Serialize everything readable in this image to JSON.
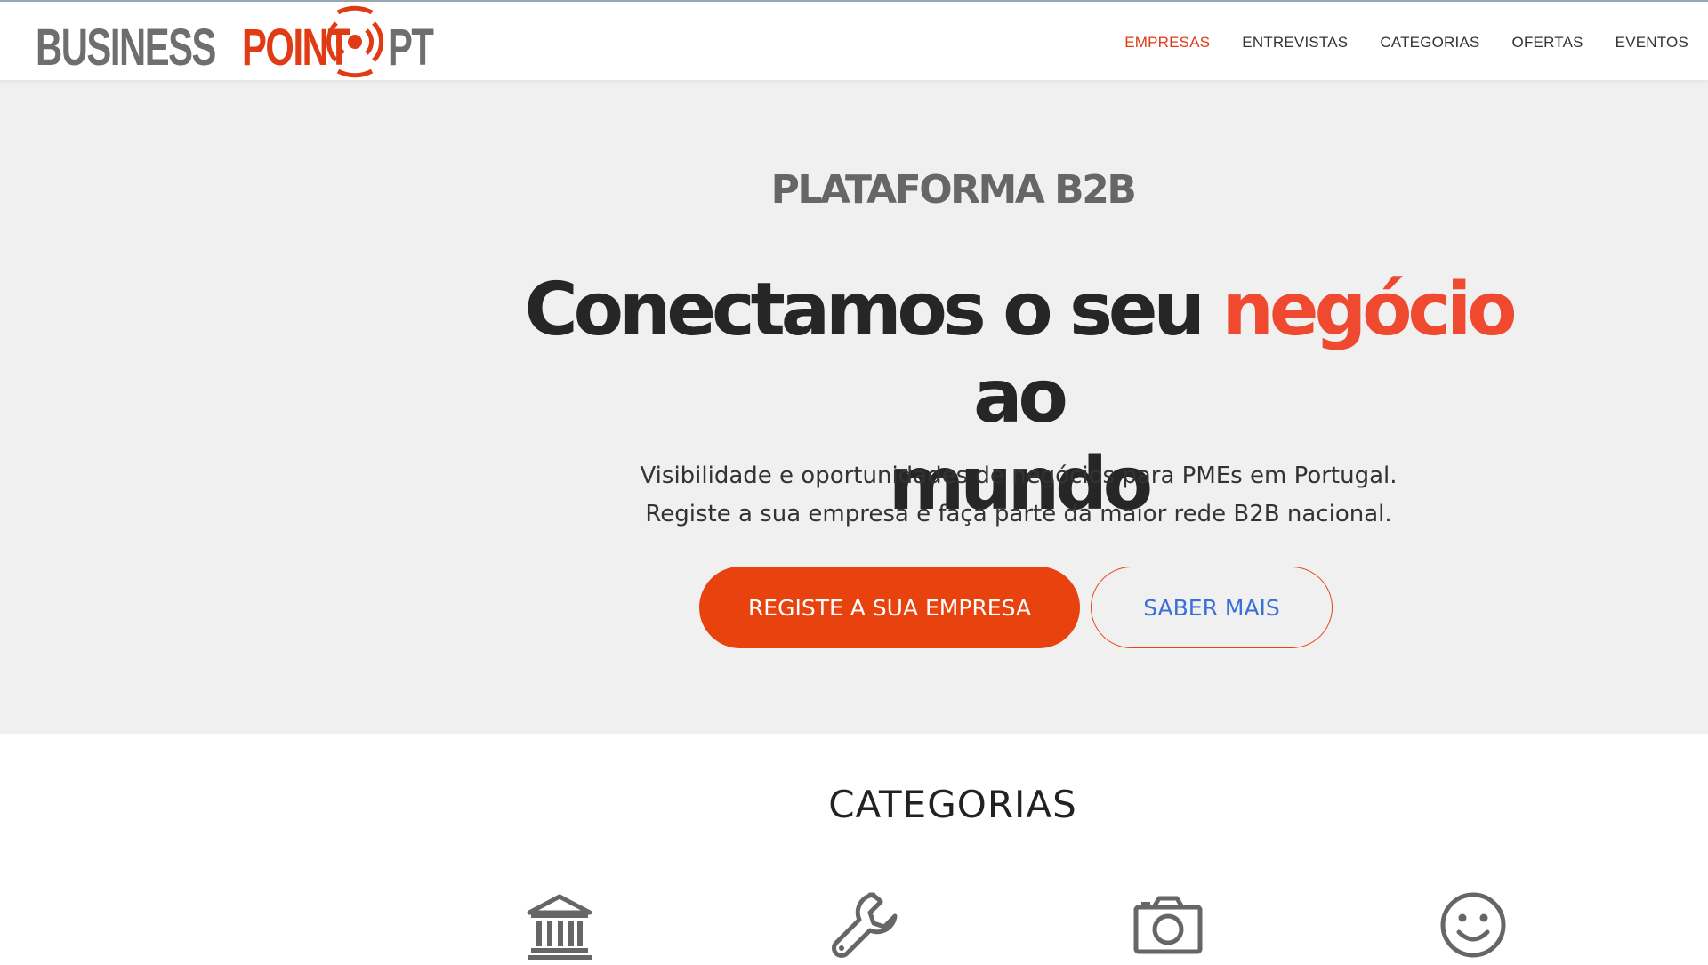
{
  "header": {
    "logo": {
      "business": "BUSINESS",
      "point": "POINT",
      "pt": "PT"
    },
    "nav": [
      {
        "label": "EMPRESAS",
        "active": true
      },
      {
        "label": "ENTREVISTAS",
        "active": false
      },
      {
        "label": "CATEGORIAS",
        "active": false
      },
      {
        "label": "OFERTAS",
        "active": false
      },
      {
        "label": "EVENTOS",
        "active": false
      }
    ]
  },
  "hero": {
    "eyebrow": "PLATAFORMA B2B",
    "headline": {
      "part1": "Conectamos o seu ",
      "accent": "negócio",
      "part2": " ao",
      "line2": "mundo"
    },
    "subtitle": {
      "line1": "Visibilidade e oportunidades de negócios para PMEs em Portugal.",
      "line2": "Registe a sua empresa e faça parte da maior rede B2B nacional."
    },
    "primary_button": "REGISTE A SUA EMPRESA",
    "secondary_button": "SABER MAIS"
  },
  "categories": {
    "title": "CATEGORIAS",
    "icons": [
      "bank-icon",
      "wrench-icon",
      "camera-icon",
      "smiley-icon"
    ]
  },
  "colors": {
    "accent": "#e8420f",
    "headline_accent": "#ef4a30",
    "hero_bg": "#f0f0f0",
    "link_blue": "#3b6fd8"
  }
}
